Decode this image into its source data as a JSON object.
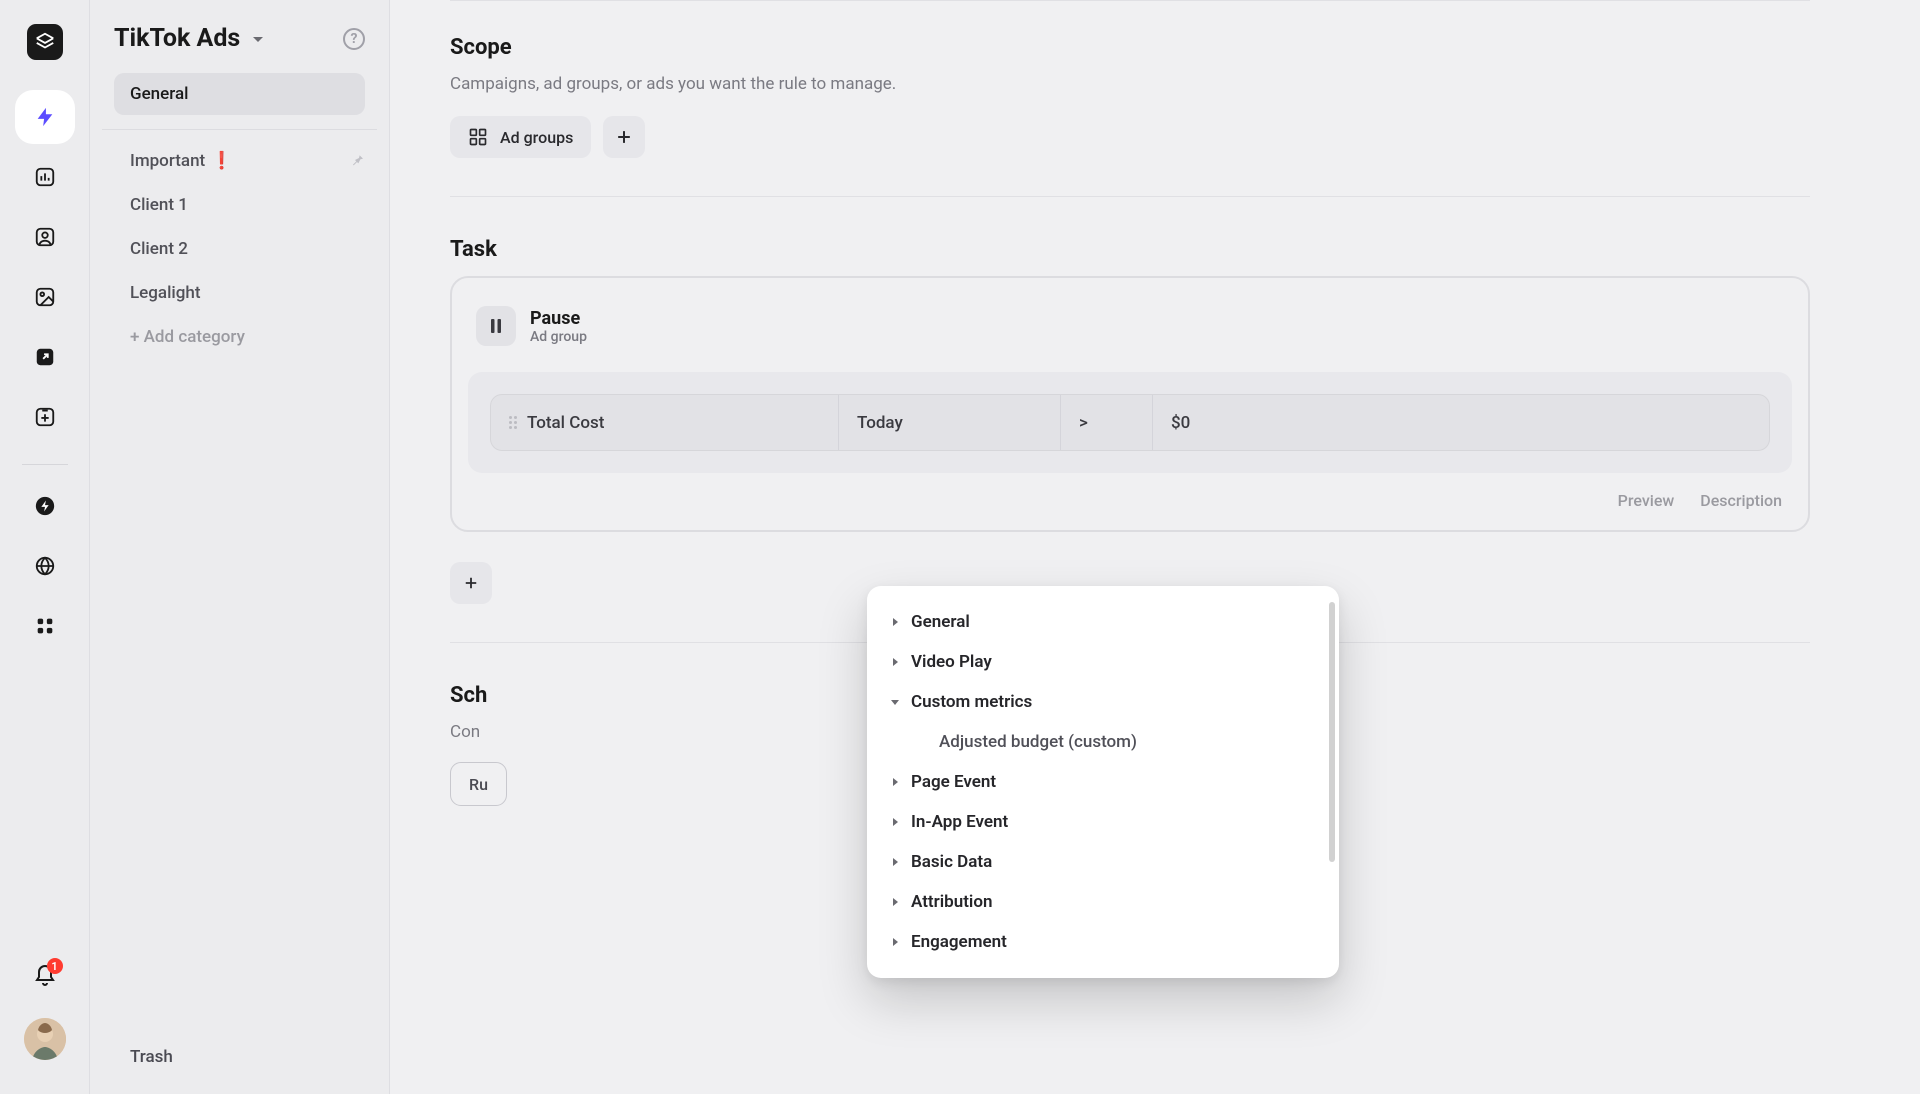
{
  "rail": {
    "notificationCount": "1"
  },
  "sidebar": {
    "title": "TikTok Ads",
    "items": {
      "general": "General",
      "important": "Important",
      "importantEmoji": "❗",
      "client1": "Client 1",
      "client2": "Client 2",
      "legalight": "Legalight"
    },
    "addCategory": "+ Add category",
    "trash": "Trash"
  },
  "scope": {
    "title": "Scope",
    "subtitle": "Campaigns, ad groups, or ads you want the rule to manage.",
    "chip_adgroups": "Ad groups"
  },
  "task": {
    "title": "Task",
    "action_title": "Pause",
    "action_sub": "Ad group",
    "cond_metric": "Total Cost",
    "cond_period": "Today",
    "cond_op": ">",
    "cond_value": "$0",
    "footer_preview": "Preview",
    "footer_description": "Description"
  },
  "dropdown": {
    "groups": {
      "general": "General",
      "videoPlay": "Video Play",
      "customMetrics": "Custom metrics",
      "customMetrics_sub1": "Adjusted budget (custom)",
      "pageEvent": "Page Event",
      "inAppEvent": "In-App Event",
      "basicData": "Basic Data",
      "attribution": "Attribution",
      "engagement": "Engagement"
    }
  },
  "schedule": {
    "title_partial": "Sch",
    "subtitle_partial": "Con",
    "button_partial": "Ru"
  }
}
